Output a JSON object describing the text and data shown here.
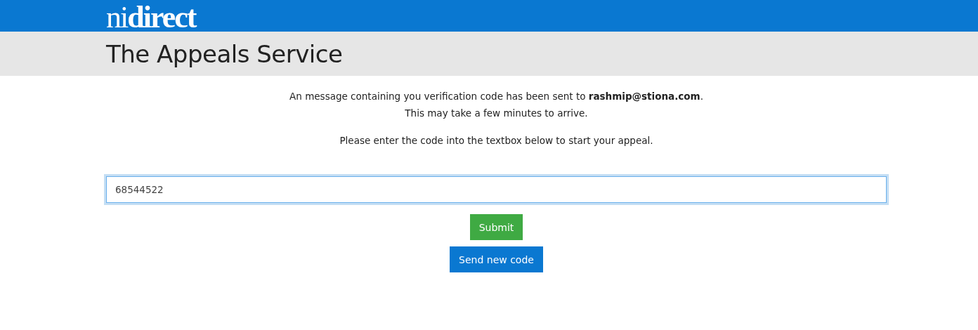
{
  "header": {
    "logo": "ni**direct**"
  },
  "banner": {
    "title": "The Appeals Service"
  },
  "message": {
    "lines": [
      "An message containing you verification code has been sent to **rashmip@stiona.com**.",
      "This may take a few minutes to arrive."
    ],
    "instruction": "Please enter the code into the textbox below to start your appeal."
  },
  "code_field": {
    "value": "68544522",
    "focused": true
  },
  "buttons": [
    {
      "label": "Submit",
      "kind": "primary"
    },
    {
      "label": "Send new code",
      "kind": "secondary"
    }
  ]
}
